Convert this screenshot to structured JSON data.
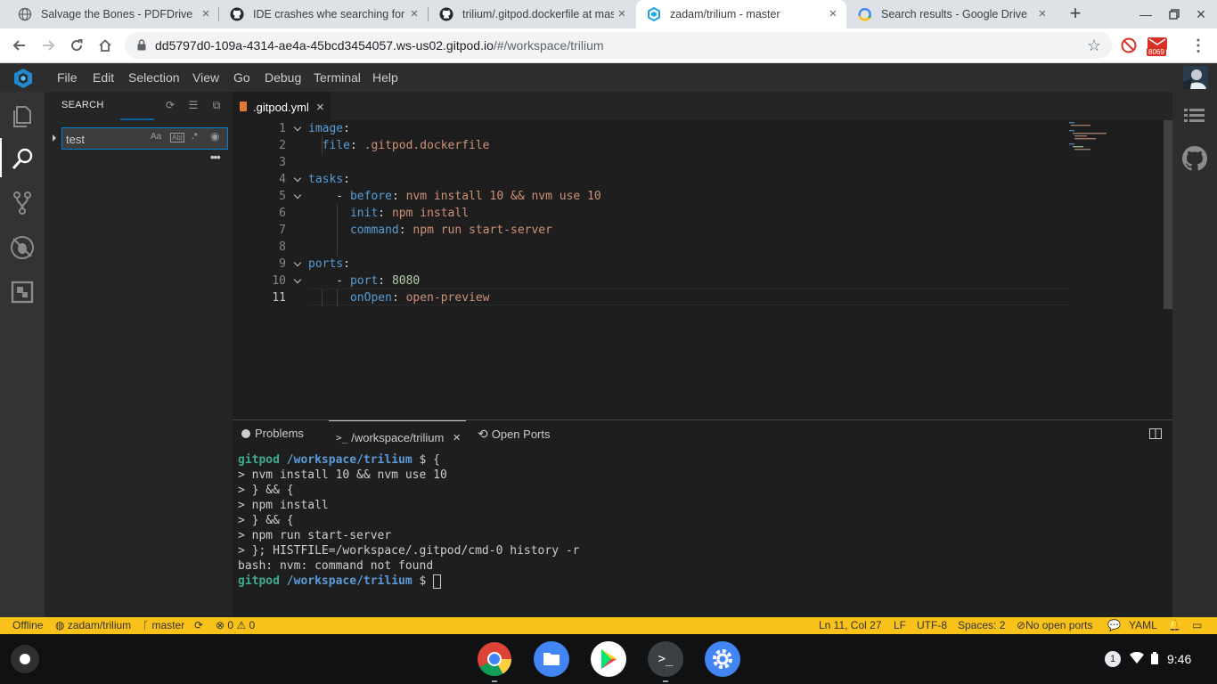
{
  "browser": {
    "tabs": [
      {
        "title": "Salvage the Bones - PDFDrive.com",
        "icon": "globe-icon"
      },
      {
        "title": "IDE crashes whe searching for strings",
        "icon": "github-icon"
      },
      {
        "title": "trilium/.gitpod.dockerfile at master",
        "icon": "github-icon"
      },
      {
        "title": "zadam/trilium - master",
        "icon": "gitpod-icon",
        "active": true
      },
      {
        "title": "Search results - Google Drive",
        "icon": "google-drive-icon"
      }
    ],
    "url_host": "dd5797d0-109a-4314-ae4a-45bcd3454057.ws-us02.gitpod.io",
    "url_path": "/#/workspace/trilium",
    "ext_badge": "8069"
  },
  "ide": {
    "menu": [
      "File",
      "Edit",
      "Selection",
      "View",
      "Go",
      "Debug",
      "Terminal",
      "Help"
    ],
    "sidebar": {
      "title": "SEARCH",
      "search_value": "test",
      "opts": [
        "Aa",
        "Ab|",
        ".*"
      ]
    },
    "editor_tab": ".gitpod.yml",
    "code_lines": [
      {
        "n": "1",
        "fold": true,
        "segs": [
          [
            "k",
            "image"
          ],
          [
            "p",
            ":"
          ]
        ]
      },
      {
        "n": "2",
        "fold": false,
        "segs": [
          [
            "p",
            "  "
          ],
          [
            "k",
            "file"
          ],
          [
            "p",
            ": "
          ],
          [
            "s",
            ".gitpod.dockerfile"
          ]
        ]
      },
      {
        "n": "3",
        "fold": false,
        "segs": []
      },
      {
        "n": "4",
        "fold": true,
        "segs": [
          [
            "k",
            "tasks"
          ],
          [
            "p",
            ":"
          ]
        ]
      },
      {
        "n": "5",
        "fold": true,
        "segs": [
          [
            "p",
            "    - "
          ],
          [
            "k",
            "before"
          ],
          [
            "p",
            ": "
          ],
          [
            "s",
            "nvm install 10 && nvm use 10"
          ]
        ]
      },
      {
        "n": "6",
        "fold": false,
        "segs": [
          [
            "p",
            "      "
          ],
          [
            "k",
            "init"
          ],
          [
            "p",
            ": "
          ],
          [
            "s",
            "npm install"
          ]
        ]
      },
      {
        "n": "7",
        "fold": false,
        "segs": [
          [
            "p",
            "      "
          ],
          [
            "k",
            "command"
          ],
          [
            "p",
            ": "
          ],
          [
            "s",
            "npm run start-server"
          ]
        ]
      },
      {
        "n": "8",
        "fold": false,
        "segs": []
      },
      {
        "n": "9",
        "fold": true,
        "segs": [
          [
            "k",
            "ports"
          ],
          [
            "p",
            ":"
          ]
        ]
      },
      {
        "n": "10",
        "fold": true,
        "segs": [
          [
            "p",
            "    - "
          ],
          [
            "k",
            "port"
          ],
          [
            "p",
            ": "
          ],
          [
            "n",
            "8080"
          ]
        ]
      },
      {
        "n": "11",
        "fold": false,
        "segs": [
          [
            "p",
            "      "
          ],
          [
            "k",
            "onOpen"
          ],
          [
            "p",
            ": "
          ],
          [
            "s",
            "open-preview"
          ]
        ]
      }
    ],
    "panel": {
      "problems": "Problems",
      "terminal": "/workspace/trilium",
      "ports": "Open Ports"
    },
    "terminal_lines": [
      {
        "type": "prompt",
        "user": "gitpod",
        "path": "/workspace/trilium",
        "rest": " $ {"
      },
      {
        "type": "text",
        "text": "> nvm install 10 && nvm use 10"
      },
      {
        "type": "text",
        "text": "> } && {"
      },
      {
        "type": "text",
        "text": "> npm install"
      },
      {
        "type": "text",
        "text": "> } && {"
      },
      {
        "type": "text",
        "text": "> npm run start-server"
      },
      {
        "type": "text",
        "text": "> }; HISTFILE=/workspace/.gitpod/cmd-0 history -r"
      },
      {
        "type": "text",
        "text": "bash: nvm: command not found"
      },
      {
        "type": "prompt",
        "user": "gitpod",
        "path": "/workspace/trilium",
        "rest": " $ ",
        "cursor": true
      }
    ],
    "status": {
      "offline": "Offline",
      "repo": "zadam/trilium",
      "branch": "master",
      "errors": "0",
      "warnings": "0",
      "position": "Ln 11, Col 27",
      "eol": "LF",
      "encoding": "UTF-8",
      "spaces": "Spaces: 2",
      "ports": "No open ports",
      "language": "YAML"
    }
  },
  "shelf": {
    "apps": [
      "chrome-icon",
      "files-icon",
      "play-store-icon",
      "terminal-icon",
      "settings-icon"
    ],
    "notif_count": "1",
    "time": "9:46"
  }
}
